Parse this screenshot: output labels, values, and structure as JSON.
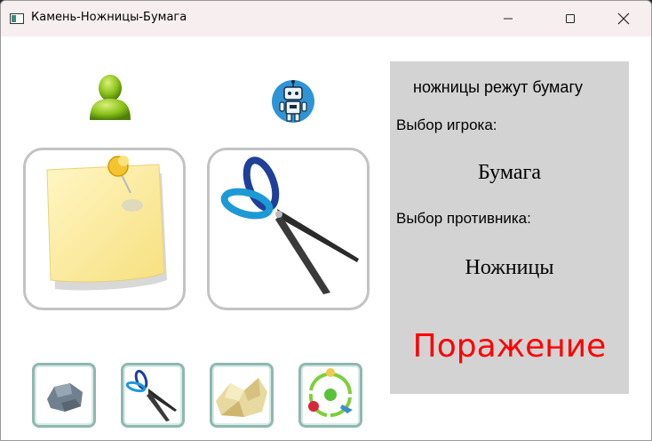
{
  "window": {
    "title": "Камень-Ножницы-Бумага",
    "controls": [
      "minimize-icon",
      "maximize-icon",
      "close-icon"
    ]
  },
  "players": {
    "player_icon": "user-icon",
    "opponent_icon": "robot-icon",
    "player_choice_image": "paper-note-icon",
    "opponent_choice_image": "scissors-icon"
  },
  "choices": [
    {
      "name": "rock",
      "icon": "rock-icon"
    },
    {
      "name": "scissors",
      "icon": "scissors-icon"
    },
    {
      "name": "paper",
      "icon": "paper-icon"
    },
    {
      "name": "random",
      "icon": "cycle-icon"
    }
  ],
  "panel": {
    "rule": "ножницы режут бумагу",
    "player_label": "Выбор игрока:",
    "player_choice": "Бумага",
    "opponent_label": "Выбор противника:",
    "opponent_choice": "Ножницы",
    "result": "Поражение",
    "result_color": "#ff0000"
  }
}
